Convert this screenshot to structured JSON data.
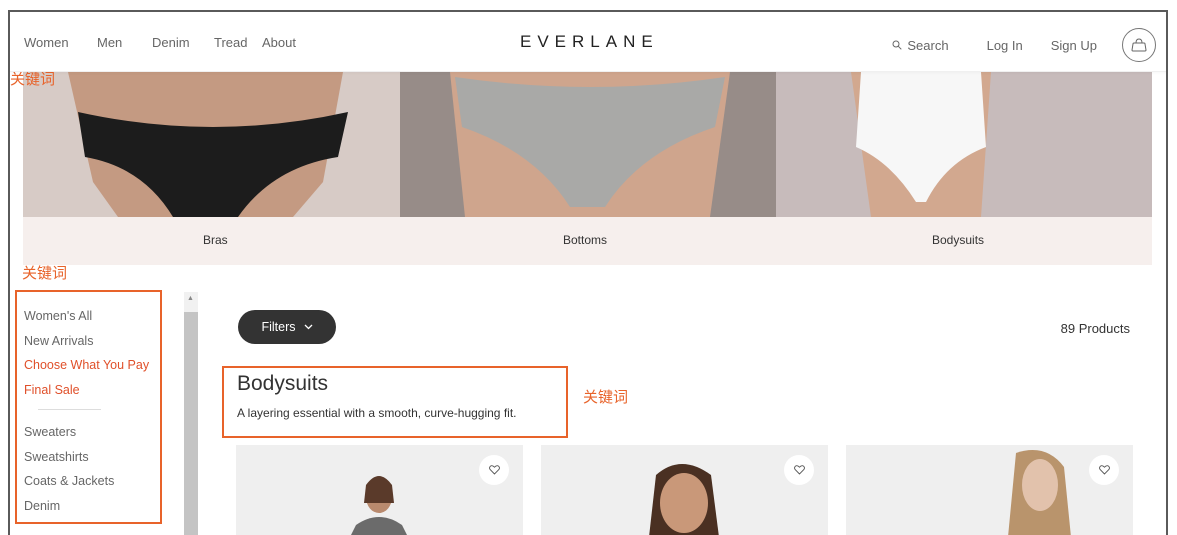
{
  "header": {
    "nav": [
      "Women",
      "Men",
      "Denim",
      "Tread",
      "About"
    ],
    "logo": "EVERLANE",
    "search_label": "Search",
    "login_label": "Log In",
    "signup_label": "Sign Up"
  },
  "hero": {
    "categories": [
      "Bras",
      "Bottoms",
      "Bodysuits"
    ]
  },
  "sidebar": {
    "group1": [
      "Women's All",
      "New Arrivals",
      "Choose What You Pay",
      "Final Sale"
    ],
    "group2": [
      "Sweaters",
      "Sweatshirts",
      "Coats & Jackets",
      "Denim"
    ]
  },
  "main": {
    "filters_label": "Filters",
    "product_count": "89 Products",
    "title": "Bodysuits",
    "subtitle": "A layering essential with a smooth, curve-hugging fit."
  },
  "annotations": {
    "label": "关键词"
  },
  "colors": {
    "accent": "#e0502a",
    "annotation": "#e8632a",
    "dark_button": "#333333"
  }
}
